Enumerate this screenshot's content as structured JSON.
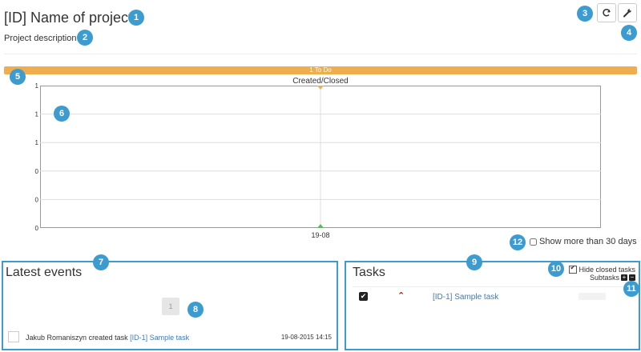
{
  "project": {
    "title": "[ID] Name of project",
    "description": "Project description"
  },
  "progress": {
    "label": "1 To Do",
    "fraction": 1.0,
    "color": "#f0ad4e"
  },
  "chart_data": {
    "type": "line",
    "title": "Created/Closed",
    "categories": [
      "19-08"
    ],
    "y_tick_labels": [
      "1",
      "1",
      "1",
      "0",
      "0",
      "0"
    ],
    "ylim": [
      0,
      1
    ],
    "series": [
      {
        "values": [
          1
        ],
        "color": "#f0ad4e"
      },
      {
        "values": [
          0
        ],
        "color": "#5cb85c"
      }
    ],
    "grid": true
  },
  "chart_options": {
    "show_more_label": "Show more than 30 days",
    "show_more_checked": false
  },
  "events": {
    "title": "Latest events",
    "pager": [
      "1"
    ],
    "items": [
      {
        "actor": "Jakub Romaniszyn",
        "action": "created task",
        "task": "[ID-1] Sample task",
        "date": "19-08-2015 14:15"
      }
    ]
  },
  "tasks": {
    "title": "Tasks",
    "hide_closed_label": "Hide closed tasks",
    "hide_closed_checked": true,
    "subtasks_label": "Subtasks",
    "expand_label": "+",
    "collapse_label": "−",
    "items": [
      {
        "name": "[ID-1] Sample task",
        "checked": true,
        "priority_icon": "chevron-up-icon",
        "check_mark": "✔",
        "priority_glyph": "⌃"
      }
    ]
  },
  "callouts": [
    "1",
    "2",
    "3",
    "4",
    "5",
    "6",
    "7",
    "8",
    "9",
    "10",
    "11",
    "12"
  ],
  "colors": {
    "accent": "#3d9ccf",
    "progress": "#f0ad4e",
    "link": "#3d7ab8",
    "priority": "#a01818"
  }
}
